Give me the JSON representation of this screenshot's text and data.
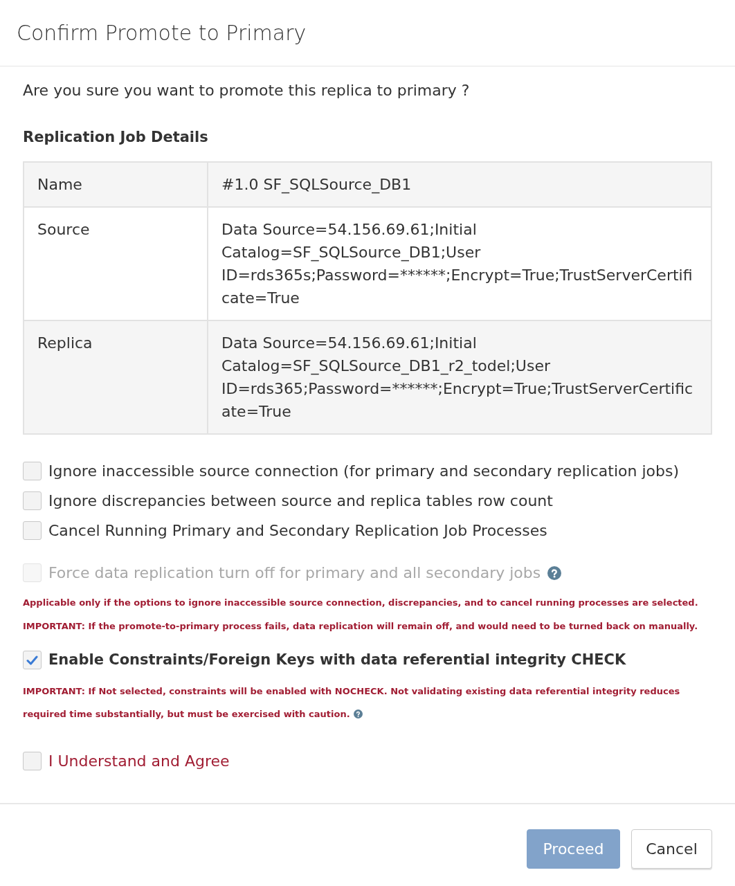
{
  "dialog": {
    "title": "Confirm Promote to Primary"
  },
  "question": "Are you sure you want to promote this replica to primary ?",
  "details": {
    "heading": "Replication Job Details",
    "rows": [
      {
        "label": "Name",
        "value": "#1.0 SF_SQLSource_DB1"
      },
      {
        "label": "Source",
        "value": "Data Source=54.156.69.61;Initial Catalog=SF_SQLSource_DB1;User ID=rds365s;Password=******;Encrypt=True;TrustServerCertificate=True"
      },
      {
        "label": "Replica",
        "value": "Data Source=54.156.69.61;Initial Catalog=SF_SQLSource_DB1_r2_todel;User ID=rds365;Password=******;Encrypt=True;TrustServerCertificate=True"
      }
    ]
  },
  "options": [
    {
      "label": "Ignore inaccessible source connection (for primary and secondary replication jobs)",
      "checked": false,
      "disabled": false
    },
    {
      "label": "Ignore discrepancies between source and replica tables row count",
      "checked": false,
      "disabled": false
    },
    {
      "label": "Cancel Running Primary and Secondary Replication Job Processes",
      "checked": false,
      "disabled": false
    }
  ],
  "force_option": {
    "label": "Force data replication turn off for primary and all secondary jobs",
    "checked": false,
    "disabled": true,
    "help": true
  },
  "force_notes": [
    "Applicable only if the options to ignore inaccessible source connection, discrepancies, and to cancel running processes are selected.",
    "IMPORTANT: If the promote-to-primary process fails, data replication will remain off, and would need to be turned back on manually."
  ],
  "integrity_option": {
    "label": "Enable Constraints/Foreign Keys with data referential integrity CHECK",
    "checked": true,
    "disabled": false
  },
  "integrity_note": {
    "text": "IMPORTANT: If Not selected, constraints will be enabled with NOCHECK. Not validating existing data referential integrity reduces required time substantially, but must be exercised with caution.",
    "help": true
  },
  "agreement": {
    "label": "I Understand and Agree",
    "checked": false
  },
  "buttons": [
    {
      "label": "Proceed",
      "kind": "primary",
      "disabled": true
    },
    {
      "label": "Cancel",
      "kind": "default",
      "disabled": false
    }
  ]
}
